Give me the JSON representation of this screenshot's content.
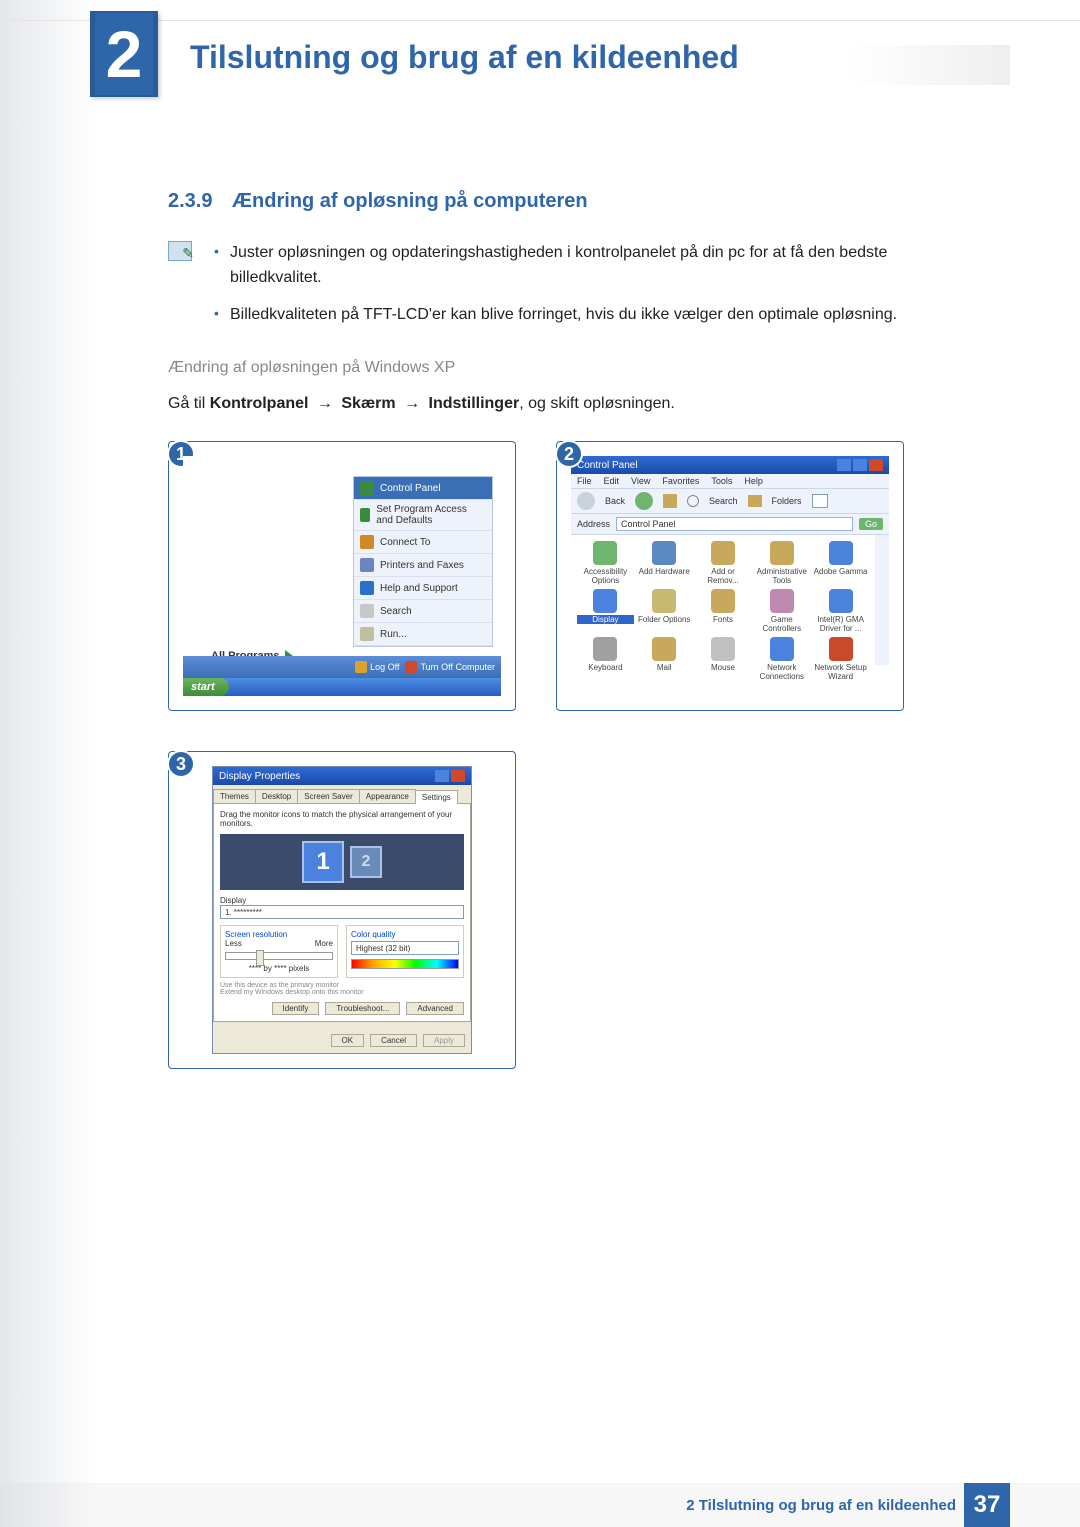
{
  "chapter": {
    "number": "2",
    "title": "Tilslutning og brug af en kildeenhed"
  },
  "section": {
    "number": "2.3.9",
    "title": "Ændring af opløsning på computeren"
  },
  "notes": [
    "Juster opløsningen og opdateringshastigheden i kontrolpanelet på din pc for at få den bedste billedkvalitet.",
    "Billedkvaliteten på TFT-LCD'er kan blive forringet, hvis du ikke vælger den optimale opløsning."
  ],
  "subintro": "Ændring af opløsningen på Windows XP",
  "path": {
    "prefix": "Gå til ",
    "p1": "Kontrolpanel",
    "p2": "Skærm",
    "p3": "Indstillinger",
    "suffix": ", og skift opløsningen."
  },
  "badges": {
    "b1": "1",
    "b2": "2",
    "b3": "3"
  },
  "startmenu": {
    "allprograms": "All Programs",
    "items": [
      {
        "label": "Control Panel",
        "hl": true,
        "color": "#3a8b3d"
      },
      {
        "label": "Set Program Access and Defaults",
        "color": "#3a8b3d"
      },
      {
        "label": "Connect To",
        "color": "#d08a2a"
      },
      {
        "label": "Printers and Faxes",
        "color": "#6a85c0"
      },
      {
        "label": "Help and Support",
        "color": "#2a6fc8"
      },
      {
        "label": "Search",
        "color": "#c8c8c8"
      },
      {
        "label": "Run...",
        "color": "#c0c0a0"
      }
    ],
    "logoff": "Log Off",
    "turnoff": "Turn Off Computer",
    "start": "start"
  },
  "controlpanel": {
    "title": "Control Panel",
    "menu": [
      "File",
      "Edit",
      "View",
      "Favorites",
      "Tools",
      "Help"
    ],
    "toolbar": {
      "back": "Back",
      "search": "Search",
      "folders": "Folders"
    },
    "address_label": "Address",
    "address_value": "Control Panel",
    "go": "Go",
    "items": [
      {
        "label": "Accessibility Options",
        "color": "#6fb56f"
      },
      {
        "label": "Add Hardware",
        "color": "#5a8ac0"
      },
      {
        "label": "Add or Remov...",
        "color": "#c8a85a"
      },
      {
        "label": "Administrative Tools",
        "color": "#c8a85a"
      },
      {
        "label": "Adobe Gamma",
        "color": "#4a82dd"
      },
      {
        "label": "Display",
        "color": "#4a82dd",
        "hl": true
      },
      {
        "label": "Folder Options",
        "color": "#c8b870"
      },
      {
        "label": "Fonts",
        "color": "#c8a85a"
      },
      {
        "label": "Game Controllers",
        "color": "#c08ab0"
      },
      {
        "label": "Intel(R) GMA Driver for ...",
        "color": "#4a82dd"
      },
      {
        "label": "Keyboard",
        "color": "#a0a0a0"
      },
      {
        "label": "Mail",
        "color": "#c8a85a"
      },
      {
        "label": "Mouse",
        "color": "#c0c0c0"
      },
      {
        "label": "Network Connections",
        "color": "#4a82dd"
      },
      {
        "label": "Network Setup Wizard",
        "color": "#c84a2a"
      }
    ]
  },
  "display": {
    "title": "Display Properties",
    "tabs": [
      "Themes",
      "Desktop",
      "Screen Saver",
      "Appearance",
      "Settings"
    ],
    "instruction": "Drag the monitor icons to match the physical arrangement of your monitors.",
    "mon1": "1",
    "mon2": "2",
    "display_label": "Display",
    "display_value": "1. *********",
    "res_label": "Screen resolution",
    "res_less": "Less",
    "res_more": "More",
    "res_value": "**** by **** pixels",
    "cq_label": "Color quality",
    "cq_value": "Highest (32 bit)",
    "chk1": "Use this device as the primary monitor",
    "chk2": "Extend my Windows desktop onto this monitor",
    "btn_identify": "Identify",
    "btn_trouble": "Troubleshoot...",
    "btn_adv": "Advanced",
    "btn_ok": "OK",
    "btn_cancel": "Cancel",
    "btn_apply": "Apply"
  },
  "footer": {
    "text": "2 Tilslutning og brug af en kildeenhed",
    "page": "37"
  }
}
